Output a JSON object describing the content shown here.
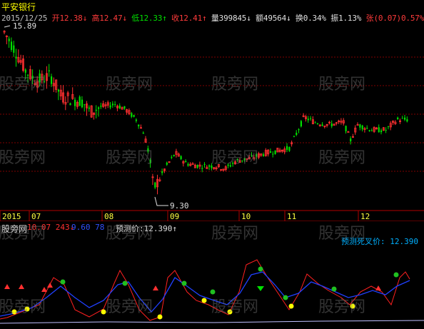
{
  "stock": {
    "name": "平安银行"
  },
  "quote": {
    "date": "2015/12/25",
    "open_label": "开",
    "open": "12.38↓",
    "high_label": "高",
    "high": "12.47↓",
    "low_label": "低",
    "low": "12.33↑",
    "close_label": "收",
    "close": "12.41↑",
    "volume_label": "量",
    "volume": "399845↓",
    "amount_label": "额",
    "amount": "49564↓",
    "turnover_label": "换",
    "turnover": "0.34%",
    "amplitude_label": "振",
    "amplitude": "1.13%",
    "change_label": "张",
    "change": "(0.07)0.57%",
    "index_label": "指"
  },
  "main_chart": {
    "high_label": "15.89",
    "low_label": "9.30",
    "x_labels": [
      "2015",
      "07",
      "08",
      "09",
      "10",
      "11",
      "12"
    ]
  },
  "indicator": {
    "name": "股旁网",
    "value1": "10.07 243↓",
    "value2": "9.60 78",
    "value3": "预测价:12.390↑",
    "forecast": "预测死叉价: 12.390"
  },
  "watermark": "股旁网",
  "colors": {
    "up": "#ff3030",
    "down": "#00e000",
    "fast_line": "#ff2020",
    "slow_line": "#2040ff",
    "green_dot": "#20c020",
    "yellow_dot": "#ffff00",
    "axis": "#b00000",
    "grid": "#800000"
  },
  "chart_data": {
    "type": "candlestick",
    "x": [
      "2015 (end)",
      "07",
      "08",
      "09",
      "10",
      "11",
      "12"
    ],
    "annotations": {
      "max": 15.89,
      "min": 9.3
    },
    "last": {
      "open": 12.38,
      "high": 12.47,
      "low": 12.33,
      "close": 12.41
    }
  }
}
